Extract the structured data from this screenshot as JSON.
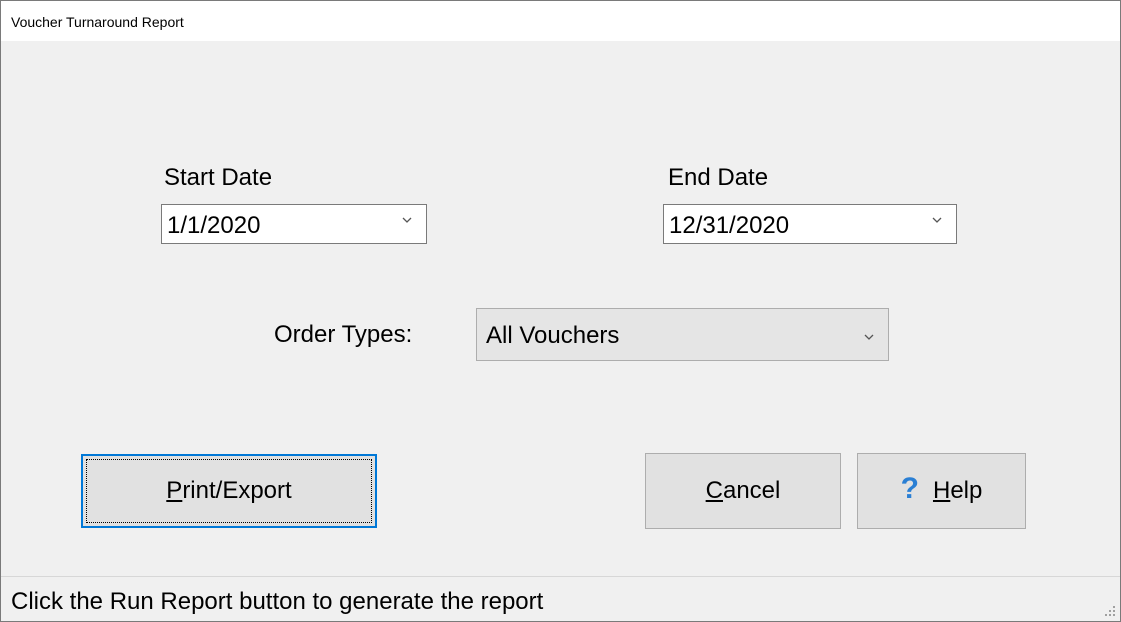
{
  "window": {
    "title": "Voucher Turnaround Report"
  },
  "start_date": {
    "label": "Start Date",
    "value": "1/1/2020"
  },
  "end_date": {
    "label": "End Date",
    "value": "12/31/2020"
  },
  "order_types": {
    "label": "Order Types:",
    "value": "All Vouchers"
  },
  "buttons": {
    "print_export": "Print/Export",
    "cancel": "Cancel",
    "help": "Help",
    "help_icon": "?"
  },
  "status": {
    "text": "Click the Run Report button to generate the report"
  },
  "icons": {
    "dropdown": "chevron-down-icon",
    "help": "question-mark-icon",
    "grip": "resize-grip-icon"
  },
  "colors": {
    "accent": "#0078d7",
    "help_icon": "#2a7fd4",
    "window_bg": "#f0f0f0"
  }
}
